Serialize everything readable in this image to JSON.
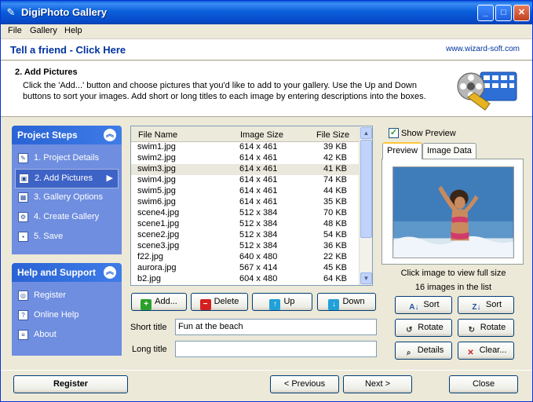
{
  "window": {
    "title": "DigiPhoto Gallery"
  },
  "menu": [
    "File",
    "Gallery",
    "Help"
  ],
  "banner": {
    "tell_friend": "Tell a friend - Click Here",
    "site": "www.wizard-soft.com"
  },
  "step": {
    "heading": "2. Add Pictures",
    "description": "Click the 'Add...' button and choose pictures that you'd like to add to your gallery.  Use the Up and Down buttons to sort your images.  Add short or long titles to each image by entering descriptions into the boxes."
  },
  "project_steps": {
    "title": "Project Steps",
    "items": [
      {
        "label": "1. Project Details",
        "icon": "pencil-icon"
      },
      {
        "label": "2. Add Pictures",
        "icon": "picture-icon"
      },
      {
        "label": "3. Gallery Options",
        "icon": "grid-icon"
      },
      {
        "label": "4. Create Gallery",
        "icon": "gear-icon"
      },
      {
        "label": "5. Save",
        "icon": "floppy-icon"
      }
    ],
    "active_index": 1
  },
  "help_support": {
    "title": "Help and Support",
    "items": [
      {
        "label": "Register",
        "icon": "register-icon"
      },
      {
        "label": "Online Help",
        "icon": "help-icon"
      },
      {
        "label": "About",
        "icon": "about-icon"
      }
    ]
  },
  "file_list": {
    "columns": [
      "File Name",
      "Image Size",
      "File Size"
    ],
    "rows": [
      [
        "swim1.jpg",
        "614 x 461",
        "39 KB"
      ],
      [
        "swim2.jpg",
        "614 x 461",
        "42 KB"
      ],
      [
        "swim3.jpg",
        "614 x 461",
        "41 KB"
      ],
      [
        "swim4.jpg",
        "614 x 461",
        "74 KB"
      ],
      [
        "swim5.jpg",
        "614 x 461",
        "44 KB"
      ],
      [
        "swim6.jpg",
        "614 x 461",
        "35 KB"
      ],
      [
        "scene4.jpg",
        "512 x 384",
        "70 KB"
      ],
      [
        "scene1.jpg",
        "512 x 384",
        "48 KB"
      ],
      [
        "scene2.jpg",
        "512 x 384",
        "54 KB"
      ],
      [
        "scene3.jpg",
        "512 x 384",
        "36 KB"
      ],
      [
        "f22.jpg",
        "640 x 480",
        "22 KB"
      ],
      [
        "aurora.jpg",
        "567 x 414",
        "45 KB"
      ],
      [
        "b2.jpg",
        "604 x 480",
        "64 KB"
      ]
    ],
    "selected_index": 2
  },
  "list_buttons": {
    "add": "Add...",
    "delete": "Delete",
    "up": "Up",
    "down": "Down"
  },
  "titles": {
    "short_label": "Short title",
    "short_value": "Fun at the beach",
    "long_label": "Long title",
    "long_value": ""
  },
  "preview": {
    "show_preview_label": "Show Preview",
    "show_preview_checked": true,
    "tabs": [
      "Preview",
      "Image Data"
    ],
    "click_hint": "Click image to view full size",
    "count_text": "16 images in the list"
  },
  "right_buttons": {
    "sort_az": "Sort",
    "sort_za": "Sort",
    "rotate_left": "Rotate",
    "rotate_right": "Rotate",
    "details": "Details",
    "clear": "Clear..."
  },
  "footer": {
    "register": "Register",
    "previous": "< Previous",
    "next": "Next >",
    "close": "Close"
  },
  "colors": {
    "titlebar": "#0A5DD8",
    "panel_header": "#2A63D4",
    "panel_body": "#6F8EE0",
    "accent_text": "#0033A0"
  }
}
